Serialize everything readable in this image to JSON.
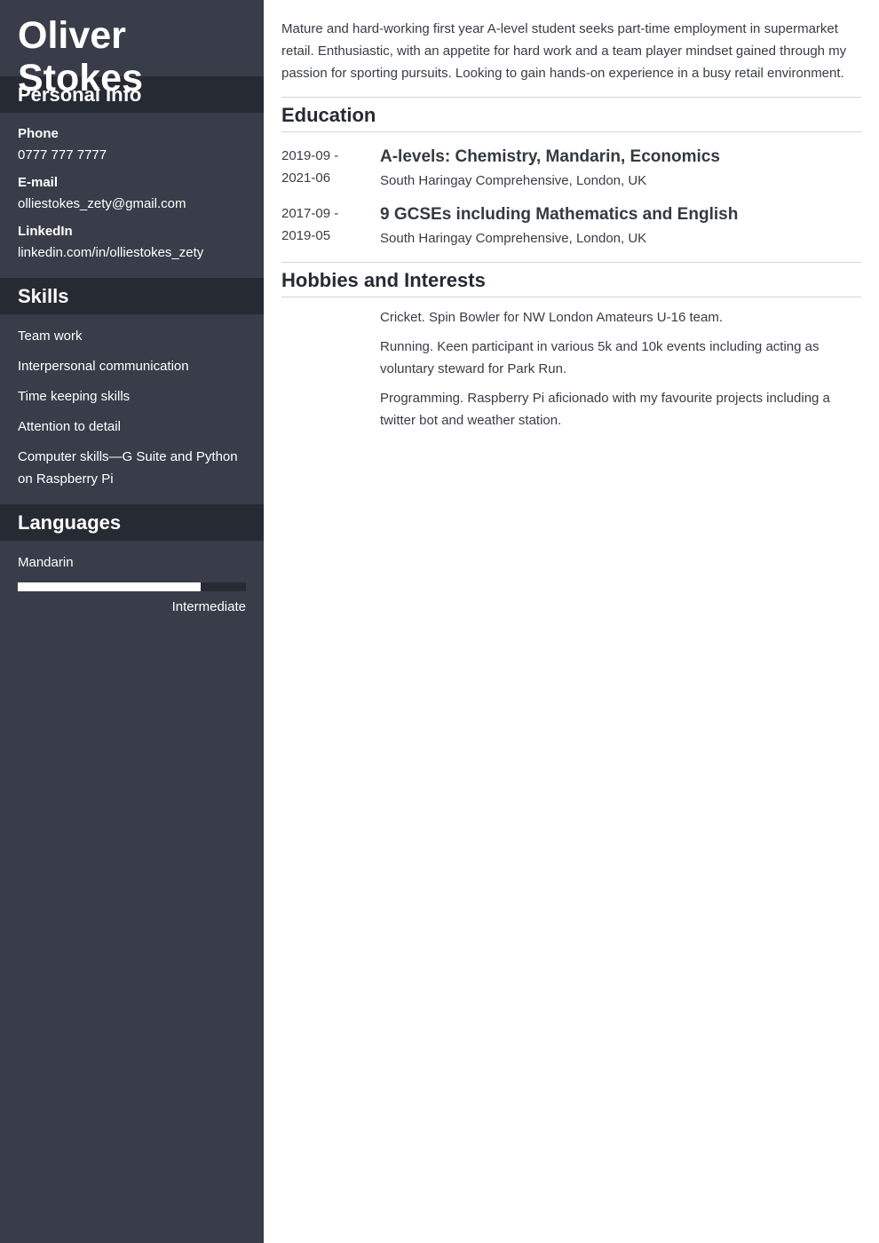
{
  "colors": {
    "sidebar_bg": "#383d49",
    "sidebar_header_bg": "#262a33",
    "text_light": "#ffffff",
    "text_dark": "#333a40",
    "divider": "#d5d5d5"
  },
  "sidebar": {
    "name": "Oliver Stokes",
    "personal_info": {
      "heading": "Personal Info",
      "fields": [
        {
          "label": "Phone",
          "value": "0777 777 7777"
        },
        {
          "label": "E-mail",
          "value": "olliestokes_zety@gmail.com"
        },
        {
          "label": "LinkedIn",
          "value": "linkedin.com/in/olliestokes_zety"
        }
      ]
    },
    "skills": {
      "heading": "Skills",
      "items": [
        "Team work",
        "Interpersonal communication",
        "Time keeping skills",
        "Attention to detail",
        "Computer skills—G Suite and Python on Raspberry Pi"
      ]
    },
    "languages": {
      "heading": "Languages",
      "items": [
        {
          "name": "Mandarin",
          "level": "Intermediate",
          "proficiency_percent": 80
        }
      ]
    }
  },
  "main": {
    "summary": "Mature and hard-working first year A-level student seeks part-time employment in supermarket retail. Enthusiastic, with an appetite for hard work and a team player mindset gained through my passion for sporting pursuits. Looking to gain hands-on experience in a busy retail environment.",
    "education": {
      "heading": "Education",
      "items": [
        {
          "date_start": "2019-09 -",
          "date_end": "2021-06",
          "title": "A-levels: Chemistry, Mandarin, Economics",
          "school": "South Haringay Comprehensive, London, UK"
        },
        {
          "date_start": "2017-09 -",
          "date_end": "2019-05",
          "title": "9 GCSEs including Mathematics and English",
          "school": "South Haringay Comprehensive, London, UK"
        }
      ]
    },
    "hobbies": {
      "heading": "Hobbies and Interests",
      "items": [
        "Cricket. Spin Bowler for NW London Amateurs U-16 team.",
        "Running. Keen participant in various 5k and 10k events including acting as voluntary steward for Park Run.",
        "Programming. Raspberry Pi aficionado with my favourite projects including a twitter bot and weather station."
      ]
    }
  }
}
